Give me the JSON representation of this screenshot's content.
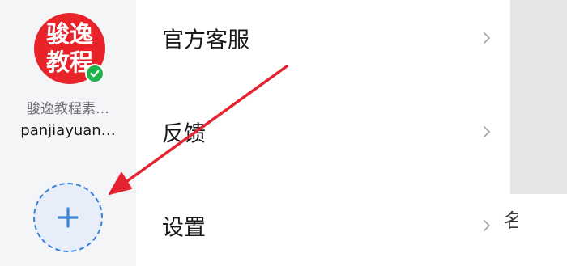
{
  "account": {
    "avatar_line1": "骏逸",
    "avatar_line2": "教程",
    "name": "骏逸教程素…",
    "id": "panjiayuan…"
  },
  "menu": {
    "items": [
      {
        "label": "官方客服"
      },
      {
        "label": "反馈"
      },
      {
        "label": "设置"
      }
    ]
  },
  "background": {
    "peek_text": "名"
  },
  "colors": {
    "avatar_bg": "#e8232a",
    "verified": "#21b34a",
    "add_button_border": "#3b83d9",
    "annotation_arrow": "#e5222f"
  },
  "icons": {
    "verified": "check-icon",
    "add": "plus-icon",
    "menu_chevron": "chevron-right-icon"
  }
}
